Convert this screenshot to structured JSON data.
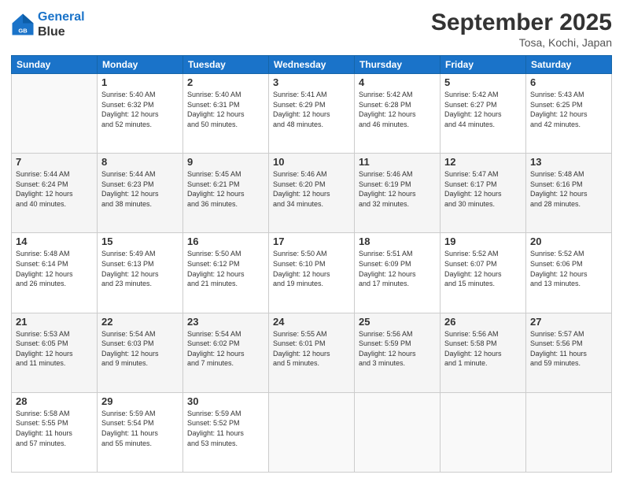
{
  "header": {
    "logo_line1": "General",
    "logo_line2": "Blue",
    "month": "September 2025",
    "location": "Tosa, Kochi, Japan"
  },
  "weekdays": [
    "Sunday",
    "Monday",
    "Tuesday",
    "Wednesday",
    "Thursday",
    "Friday",
    "Saturday"
  ],
  "weeks": [
    [
      {
        "day": "",
        "info": ""
      },
      {
        "day": "1",
        "info": "Sunrise: 5:40 AM\nSunset: 6:32 PM\nDaylight: 12 hours\nand 52 minutes."
      },
      {
        "day": "2",
        "info": "Sunrise: 5:40 AM\nSunset: 6:31 PM\nDaylight: 12 hours\nand 50 minutes."
      },
      {
        "day": "3",
        "info": "Sunrise: 5:41 AM\nSunset: 6:29 PM\nDaylight: 12 hours\nand 48 minutes."
      },
      {
        "day": "4",
        "info": "Sunrise: 5:42 AM\nSunset: 6:28 PM\nDaylight: 12 hours\nand 46 minutes."
      },
      {
        "day": "5",
        "info": "Sunrise: 5:42 AM\nSunset: 6:27 PM\nDaylight: 12 hours\nand 44 minutes."
      },
      {
        "day": "6",
        "info": "Sunrise: 5:43 AM\nSunset: 6:25 PM\nDaylight: 12 hours\nand 42 minutes."
      }
    ],
    [
      {
        "day": "7",
        "info": "Sunrise: 5:44 AM\nSunset: 6:24 PM\nDaylight: 12 hours\nand 40 minutes."
      },
      {
        "day": "8",
        "info": "Sunrise: 5:44 AM\nSunset: 6:23 PM\nDaylight: 12 hours\nand 38 minutes."
      },
      {
        "day": "9",
        "info": "Sunrise: 5:45 AM\nSunset: 6:21 PM\nDaylight: 12 hours\nand 36 minutes."
      },
      {
        "day": "10",
        "info": "Sunrise: 5:46 AM\nSunset: 6:20 PM\nDaylight: 12 hours\nand 34 minutes."
      },
      {
        "day": "11",
        "info": "Sunrise: 5:46 AM\nSunset: 6:19 PM\nDaylight: 12 hours\nand 32 minutes."
      },
      {
        "day": "12",
        "info": "Sunrise: 5:47 AM\nSunset: 6:17 PM\nDaylight: 12 hours\nand 30 minutes."
      },
      {
        "day": "13",
        "info": "Sunrise: 5:48 AM\nSunset: 6:16 PM\nDaylight: 12 hours\nand 28 minutes."
      }
    ],
    [
      {
        "day": "14",
        "info": "Sunrise: 5:48 AM\nSunset: 6:14 PM\nDaylight: 12 hours\nand 26 minutes."
      },
      {
        "day": "15",
        "info": "Sunrise: 5:49 AM\nSunset: 6:13 PM\nDaylight: 12 hours\nand 23 minutes."
      },
      {
        "day": "16",
        "info": "Sunrise: 5:50 AM\nSunset: 6:12 PM\nDaylight: 12 hours\nand 21 minutes."
      },
      {
        "day": "17",
        "info": "Sunrise: 5:50 AM\nSunset: 6:10 PM\nDaylight: 12 hours\nand 19 minutes."
      },
      {
        "day": "18",
        "info": "Sunrise: 5:51 AM\nSunset: 6:09 PM\nDaylight: 12 hours\nand 17 minutes."
      },
      {
        "day": "19",
        "info": "Sunrise: 5:52 AM\nSunset: 6:07 PM\nDaylight: 12 hours\nand 15 minutes."
      },
      {
        "day": "20",
        "info": "Sunrise: 5:52 AM\nSunset: 6:06 PM\nDaylight: 12 hours\nand 13 minutes."
      }
    ],
    [
      {
        "day": "21",
        "info": "Sunrise: 5:53 AM\nSunset: 6:05 PM\nDaylight: 12 hours\nand 11 minutes."
      },
      {
        "day": "22",
        "info": "Sunrise: 5:54 AM\nSunset: 6:03 PM\nDaylight: 12 hours\nand 9 minutes."
      },
      {
        "day": "23",
        "info": "Sunrise: 5:54 AM\nSunset: 6:02 PM\nDaylight: 12 hours\nand 7 minutes."
      },
      {
        "day": "24",
        "info": "Sunrise: 5:55 AM\nSunset: 6:01 PM\nDaylight: 12 hours\nand 5 minutes."
      },
      {
        "day": "25",
        "info": "Sunrise: 5:56 AM\nSunset: 5:59 PM\nDaylight: 12 hours\nand 3 minutes."
      },
      {
        "day": "26",
        "info": "Sunrise: 5:56 AM\nSunset: 5:58 PM\nDaylight: 12 hours\nand 1 minute."
      },
      {
        "day": "27",
        "info": "Sunrise: 5:57 AM\nSunset: 5:56 PM\nDaylight: 11 hours\nand 59 minutes."
      }
    ],
    [
      {
        "day": "28",
        "info": "Sunrise: 5:58 AM\nSunset: 5:55 PM\nDaylight: 11 hours\nand 57 minutes."
      },
      {
        "day": "29",
        "info": "Sunrise: 5:59 AM\nSunset: 5:54 PM\nDaylight: 11 hours\nand 55 minutes."
      },
      {
        "day": "30",
        "info": "Sunrise: 5:59 AM\nSunset: 5:52 PM\nDaylight: 11 hours\nand 53 minutes."
      },
      {
        "day": "",
        "info": ""
      },
      {
        "day": "",
        "info": ""
      },
      {
        "day": "",
        "info": ""
      },
      {
        "day": "",
        "info": ""
      }
    ]
  ]
}
